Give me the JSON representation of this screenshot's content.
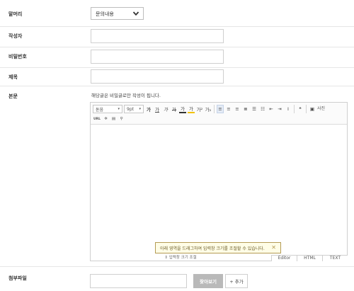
{
  "form": {
    "category": {
      "label": "말머리",
      "selected": "문의내용"
    },
    "author": {
      "label": "작성자",
      "value": ""
    },
    "password": {
      "label": "비밀번호",
      "value": ""
    },
    "title": {
      "label": "제목",
      "value": ""
    },
    "body": {
      "label": "본문",
      "notice": "해당글은 비밀글로만 작성이 됩니다.",
      "editor": {
        "font_family": "돋움",
        "font_size": "9pt",
        "toolbar_icons": [
          "bold",
          "underline",
          "italic",
          "strikethrough",
          "font-color",
          "highlight",
          "superscript",
          "subscript",
          "align-left",
          "align-center",
          "align-right",
          "align-justify",
          "ordered-list",
          "unordered-list",
          "outdent",
          "indent",
          "clear-format",
          "quote"
        ],
        "toolbar_row1_glyphs": [
          "가",
          "가",
          "가",
          "가",
          "가",
          "가",
          "가²",
          "가₂"
        ],
        "photo_label": "사진",
        "row2_icons": [
          "url-icon",
          "special-char-icon",
          "table-icon",
          "search-icon"
        ],
        "url_label": "URL",
        "tooltip": "아래 영역을 드래그하여 입력창 크기를 조절할 수 있습니다.",
        "resize_label": "⇕ 입력창 크기 조절",
        "mode_tabs": [
          "Editor",
          "HTML",
          "TEXT"
        ]
      }
    },
    "attachment": {
      "label": "첨부파일",
      "browse_label": "찾아보기",
      "add_label": "+ 추가"
    }
  }
}
